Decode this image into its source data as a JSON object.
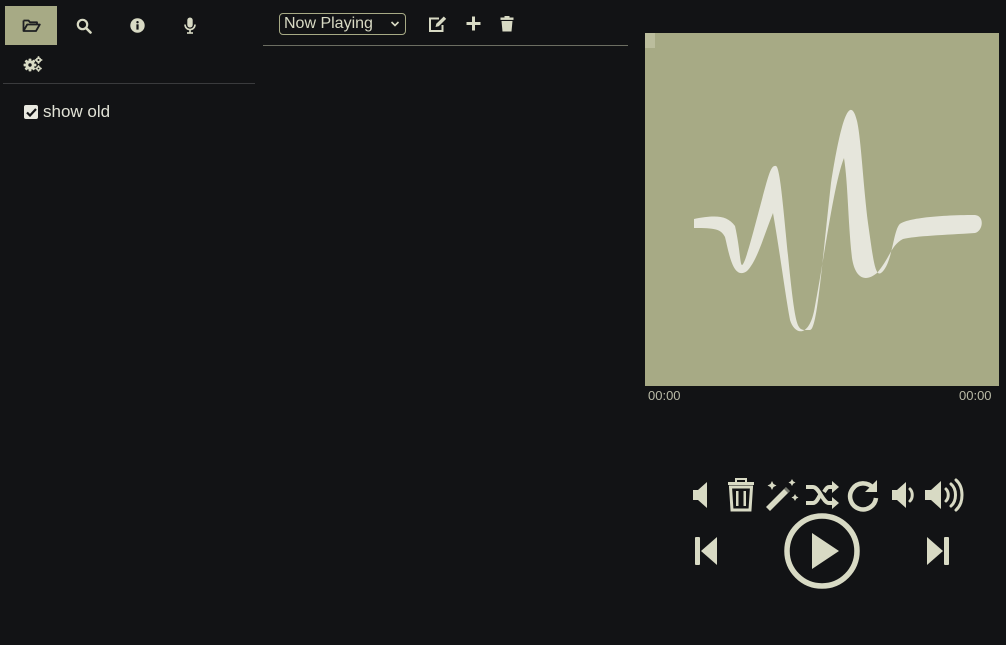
{
  "sidebar": {
    "tabs": [
      {
        "name": "folder-open-icon",
        "active": true
      },
      {
        "name": "search-icon",
        "active": false
      },
      {
        "name": "info-icon",
        "active": false
      },
      {
        "name": "microphone-icon",
        "active": false
      }
    ],
    "settings_icon": "cogs-icon",
    "show_old": {
      "label": "show old",
      "checked": true
    }
  },
  "toolbar": {
    "playlist_select": {
      "selected": "Now Playing"
    },
    "buttons": [
      "edit-icon",
      "plus-icon",
      "trash-icon"
    ]
  },
  "player": {
    "album_art_icon": "waveform-icon",
    "elapsed": "00:00",
    "duration": "00:00",
    "controls_top": [
      "volume-off-icon",
      "trash-icon",
      "magic-wand-icon",
      "shuffle-icon",
      "repeat-icon",
      "volume-down-icon",
      "volume-up-icon"
    ],
    "controls_bottom": [
      "step-backward-icon",
      "play-circle-icon",
      "step-forward-icon"
    ]
  },
  "colors": {
    "background": "#121315",
    "accent": "#a7aa85",
    "icon": "#d8dac4"
  }
}
